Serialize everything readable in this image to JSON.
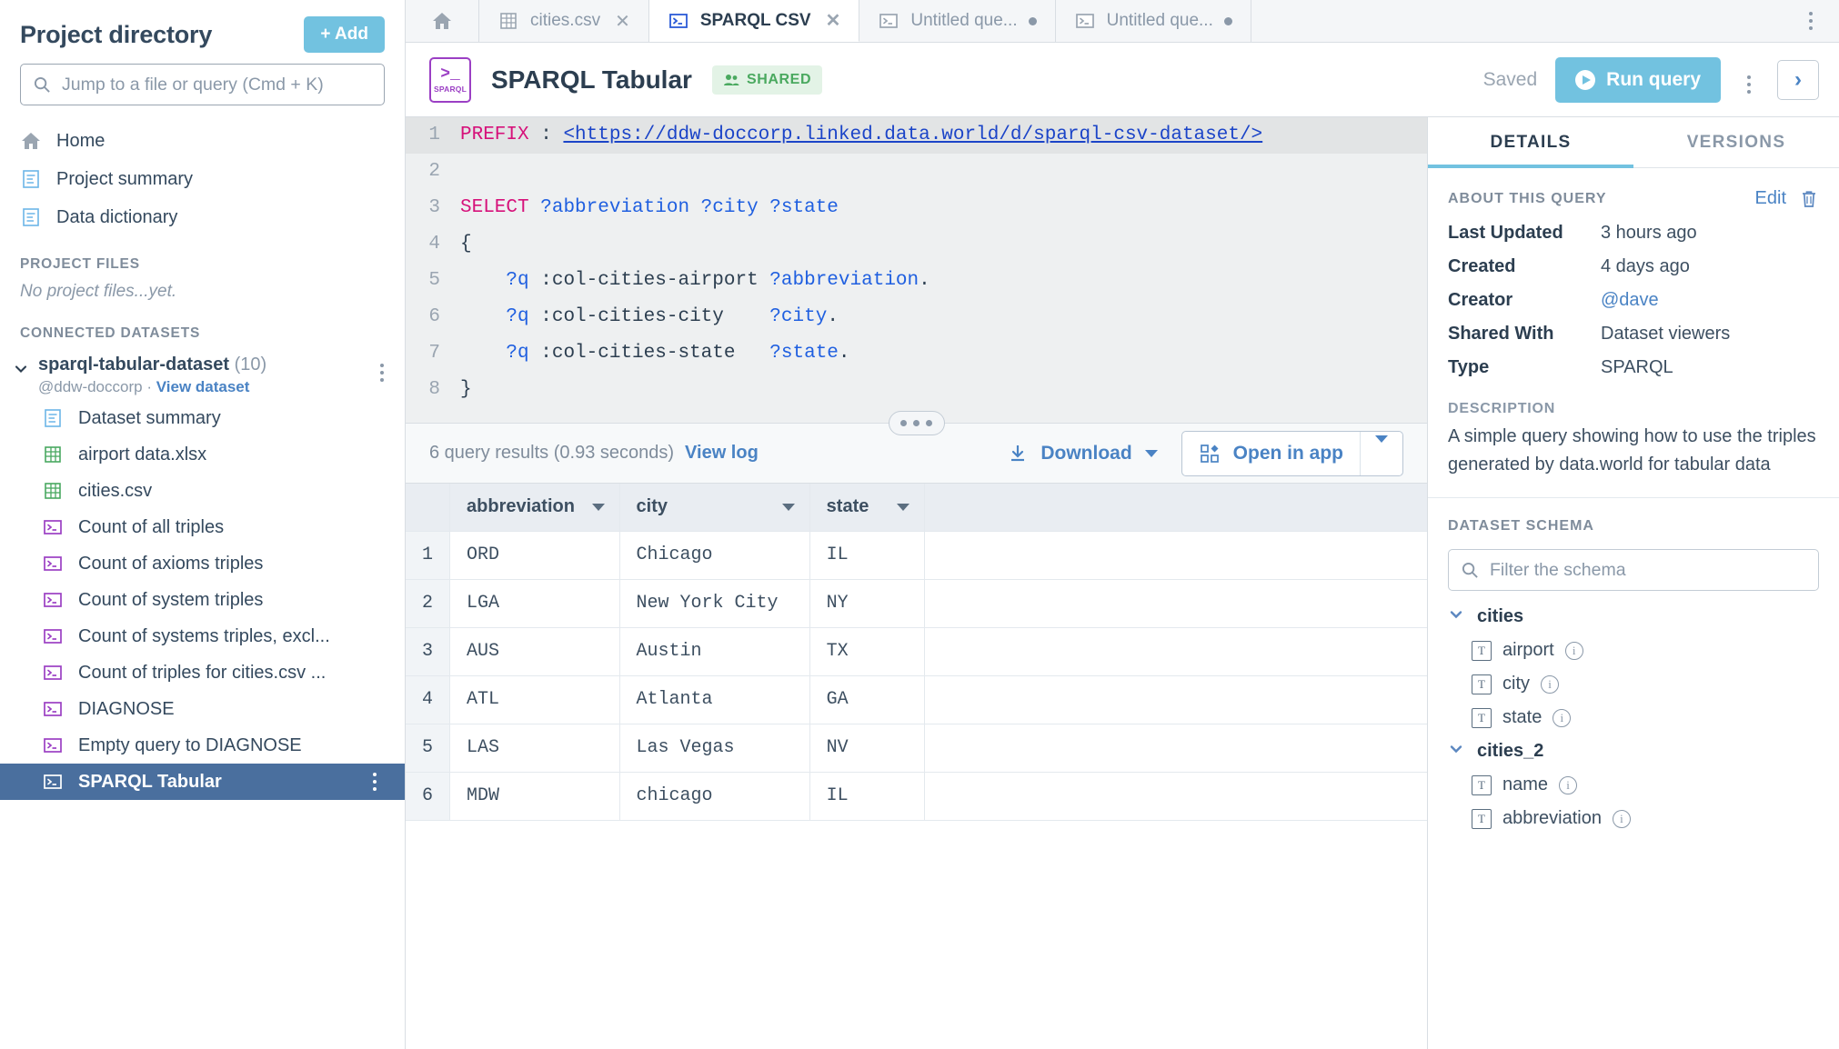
{
  "sidebar": {
    "title": "Project directory",
    "add_label": "+ Add",
    "search_placeholder": "Jump to a file or query (Cmd + K)",
    "nav": [
      {
        "label": "Home",
        "icon": "home-icon"
      },
      {
        "label": "Project summary",
        "icon": "document-icon"
      },
      {
        "label": "Data dictionary",
        "icon": "document-icon"
      }
    ],
    "project_files_label": "PROJECT FILES",
    "no_files_text": "No project files...yet.",
    "connected_datasets_label": "CONNECTED DATASETS",
    "dataset": {
      "name": "sparql-tabular-dataset",
      "count": "(10)",
      "owner": "@ddw-doccorp",
      "separator": "·",
      "view_link": "View dataset"
    },
    "files": [
      {
        "label": "Dataset summary",
        "icon": "document-icon",
        "active": false
      },
      {
        "label": "airport data.xlsx",
        "icon": "spreadsheet-icon",
        "active": false
      },
      {
        "label": "cities.csv",
        "icon": "spreadsheet-icon",
        "active": false
      },
      {
        "label": "Count of all triples",
        "icon": "query-icon",
        "active": false
      },
      {
        "label": "Count of axioms triples",
        "icon": "query-icon",
        "active": false
      },
      {
        "label": "Count of system triples",
        "icon": "query-icon",
        "active": false
      },
      {
        "label": "Count of systems triples, excl...",
        "icon": "query-icon",
        "active": false
      },
      {
        "label": "Count of triples for cities.csv ...",
        "icon": "query-icon",
        "active": false
      },
      {
        "label": "DIAGNOSE",
        "icon": "query-icon",
        "active": false
      },
      {
        "label": "Empty query to DIAGNOSE",
        "icon": "query-icon",
        "active": false
      },
      {
        "label": "SPARQL Tabular",
        "icon": "query-icon",
        "active": true
      }
    ]
  },
  "tabs": [
    {
      "label": "",
      "icon": "home-icon",
      "active": false,
      "closable": false,
      "modified": false
    },
    {
      "label": "cities.csv",
      "icon": "spreadsheet-icon",
      "active": false,
      "closable": true,
      "modified": false
    },
    {
      "label": "SPARQL CSV",
      "icon": "query-icon",
      "active": true,
      "closable": true,
      "modified": false
    },
    {
      "label": "Untitled que...",
      "icon": "query-icon",
      "active": false,
      "closable": false,
      "modified": true
    },
    {
      "label": "Untitled que...",
      "icon": "query-icon",
      "active": false,
      "closable": false,
      "modified": true
    }
  ],
  "query_header": {
    "badge_glyph": ">_",
    "badge_label": "SPARQL",
    "title": "SPARQL Tabular",
    "shared_label": "SHARED",
    "saved_label": "Saved",
    "run_label": "Run query",
    "expand_glyph": "›"
  },
  "editor": {
    "lines": [
      {
        "n": "1",
        "highlight": true,
        "parts": [
          {
            "t": "PREFIX",
            "c": "kw"
          },
          {
            "t": " : ",
            "c": "punc"
          },
          {
            "t": "<https://ddw-doccorp.linked.data.world/d/sparql-csv-dataset/>",
            "c": "uri"
          }
        ]
      },
      {
        "n": "2",
        "highlight": false,
        "parts": []
      },
      {
        "n": "3",
        "highlight": false,
        "parts": [
          {
            "t": "SELECT",
            "c": "kw"
          },
          {
            "t": " ",
            "c": "punc"
          },
          {
            "t": "?abbreviation ?city ?state",
            "c": "var"
          }
        ]
      },
      {
        "n": "4",
        "highlight": false,
        "parts": [
          {
            "t": "{",
            "c": "punc"
          }
        ]
      },
      {
        "n": "5",
        "highlight": false,
        "parts": [
          {
            "t": "    ",
            "c": "punc"
          },
          {
            "t": "?q",
            "c": "var"
          },
          {
            "t": " :col-cities-airport ",
            "c": "punc"
          },
          {
            "t": "?abbreviation",
            "c": "var"
          },
          {
            "t": ".",
            "c": "punc"
          }
        ]
      },
      {
        "n": "6",
        "highlight": false,
        "parts": [
          {
            "t": "    ",
            "c": "punc"
          },
          {
            "t": "?q",
            "c": "var"
          },
          {
            "t": " :col-cities-city    ",
            "c": "punc"
          },
          {
            "t": "?city",
            "c": "var"
          },
          {
            "t": ".",
            "c": "punc"
          }
        ]
      },
      {
        "n": "7",
        "highlight": false,
        "parts": [
          {
            "t": "    ",
            "c": "punc"
          },
          {
            "t": "?q",
            "c": "var"
          },
          {
            "t": " :col-cities-state   ",
            "c": "punc"
          },
          {
            "t": "?state",
            "c": "var"
          },
          {
            "t": ".",
            "c": "punc"
          }
        ]
      },
      {
        "n": "8",
        "highlight": false,
        "parts": [
          {
            "t": "}",
            "c": "punc"
          }
        ]
      }
    ]
  },
  "results_toolbar": {
    "count_text": "6 query results (0.93 seconds)",
    "view_log": "View log",
    "download_label": "Download",
    "open_in_app_label": "Open in app"
  },
  "results_table": {
    "columns": [
      "abbreviation",
      "city",
      "state"
    ],
    "rows": [
      {
        "n": "1",
        "abbreviation": "ORD",
        "city": "Chicago",
        "state": "IL"
      },
      {
        "n": "2",
        "abbreviation": "LGA",
        "city": "New York City",
        "state": "NY"
      },
      {
        "n": "3",
        "abbreviation": "AUS",
        "city": "Austin",
        "state": "TX"
      },
      {
        "n": "4",
        "abbreviation": "ATL",
        "city": "Atlanta",
        "state": "GA"
      },
      {
        "n": "5",
        "abbreviation": "LAS",
        "city": "Las Vegas",
        "state": "NV"
      },
      {
        "n": "6",
        "abbreviation": "MDW",
        "city": "chicago",
        "state": "IL"
      }
    ]
  },
  "right_panel": {
    "tabs": [
      {
        "label": "DETAILS",
        "active": true
      },
      {
        "label": "VERSIONS",
        "active": false
      }
    ],
    "about_label": "ABOUT THIS QUERY",
    "edit_label": "Edit",
    "meta": [
      {
        "key": "Last Updated",
        "value": "3 hours ago",
        "link": false
      },
      {
        "key": "Created",
        "value": "4 days ago",
        "link": false
      },
      {
        "key": "Creator",
        "value": "@dave",
        "link": true
      },
      {
        "key": "Shared With",
        "value": "Dataset viewers",
        "link": false
      },
      {
        "key": "Type",
        "value": "SPARQL",
        "link": false
      }
    ],
    "description_label": "DESCRIPTION",
    "description_text": "A simple query showing how to use the triples generated by data.world for tabular data",
    "schema_label": "DATASET SCHEMA",
    "schema_filter_placeholder": "Filter the schema",
    "schema": [
      {
        "table": "cities",
        "columns": [
          "airport",
          "city",
          "state"
        ]
      },
      {
        "table": "cities_2",
        "columns": [
          "name",
          "abbreviation"
        ]
      }
    ]
  },
  "colors": {
    "accent_blue": "#72c2e0",
    "link_blue": "#4a83c4",
    "selected_row": "#4a6f9e",
    "sparql_purple": "#9b3fc4",
    "shared_green": "#4aa95f",
    "keyword_pink": "#d6117a",
    "variable_blue": "#1f5fe0"
  }
}
